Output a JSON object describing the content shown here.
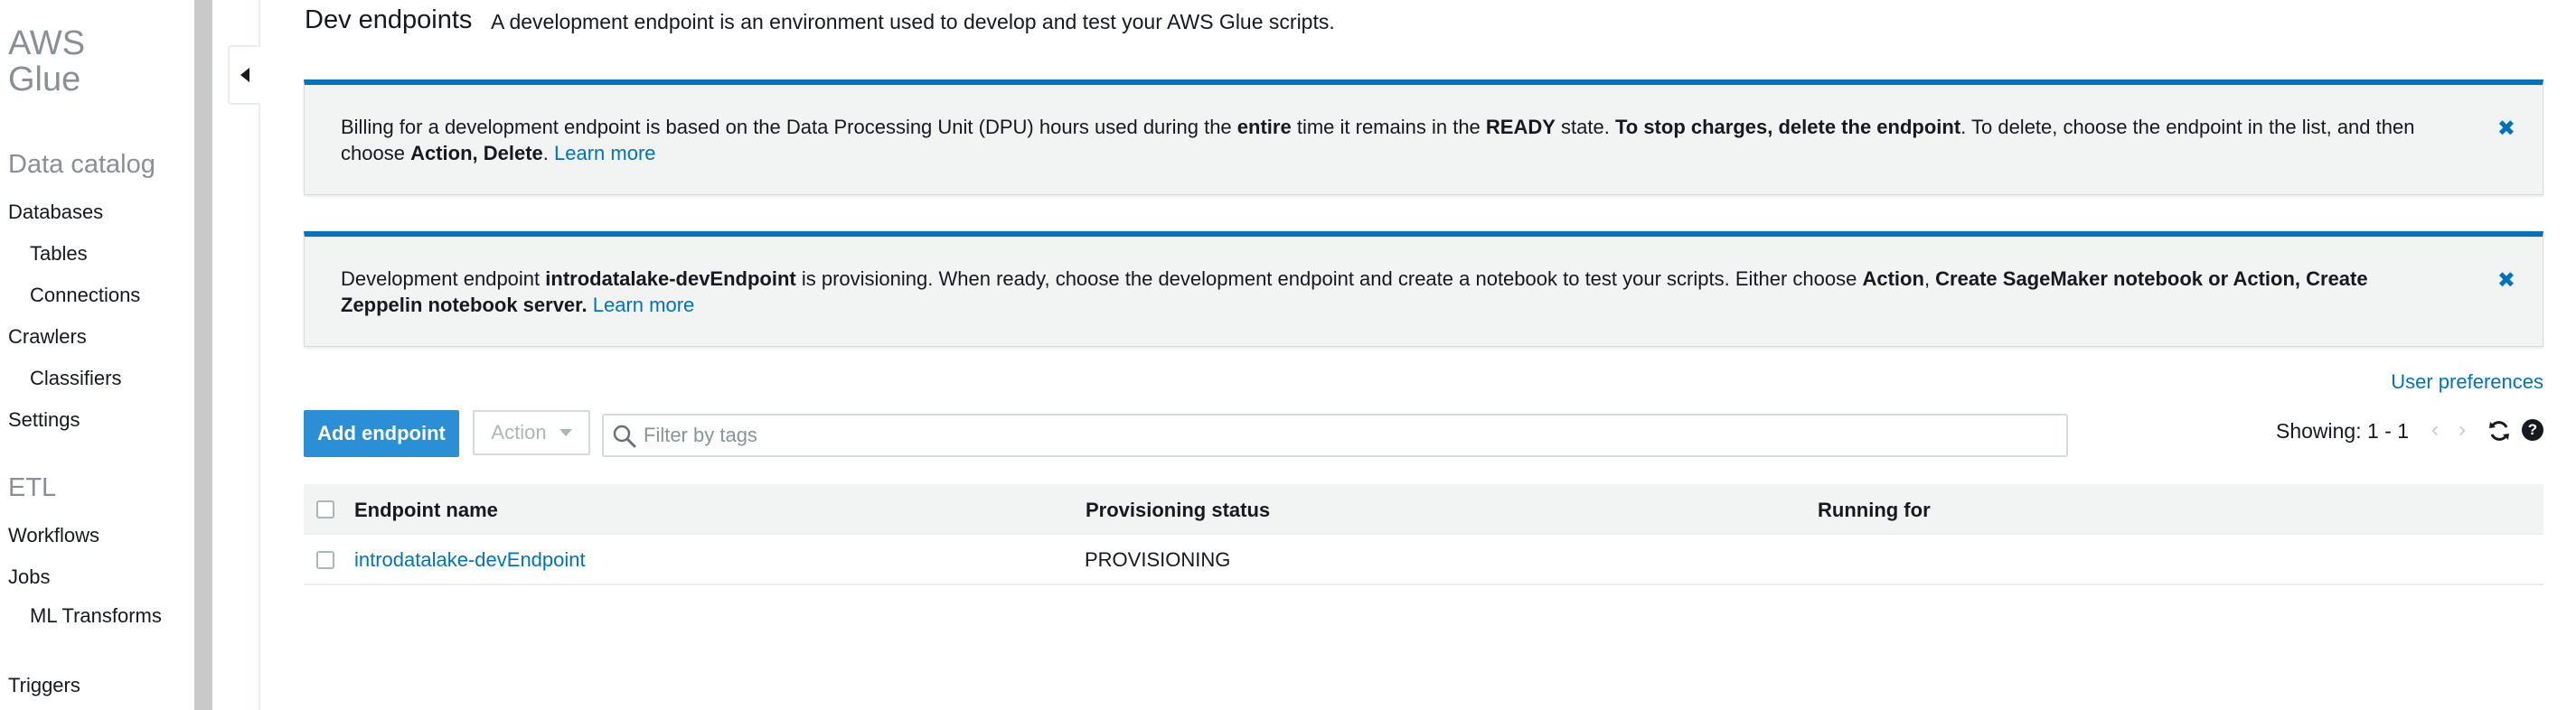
{
  "sidebar": {
    "brand_line1": "AWS",
    "brand_line2": "Glue",
    "data_catalog": {
      "title": "Data catalog",
      "items": [
        "Databases",
        "Tables",
        "Connections",
        "Crawlers",
        "Classifiers",
        "Settings"
      ]
    },
    "etl": {
      "title": "ETL",
      "items": [
        "Workflows",
        "Jobs",
        "ML Transforms",
        "Triggers"
      ]
    }
  },
  "header": {
    "title": "Dev endpoints",
    "description": "A development endpoint is an environment used to develop and test your AWS Glue scripts."
  },
  "alerts": {
    "billing": {
      "t1": "Billing for a development endpoint is based on the Data Processing Unit (DPU) hours used during the ",
      "b1": "entire",
      "t2": " time it remains in the ",
      "b2": "READY",
      "t3": " state. ",
      "b3": "To stop charges, delete the endpoint",
      "t4": ". To delete, choose the endpoint in the list, and then choose ",
      "b4": "Action, Delete",
      "t5": ". ",
      "link": "Learn more"
    },
    "provisioning": {
      "t1": "Development endpoint ",
      "b1": "introdatalake-devEndpoint",
      "t2": " is provisioning. When ready, choose the development endpoint and create a notebook to test your scripts. Either choose ",
      "b2": "Action",
      "t3": ", ",
      "b3": "Create SageMaker notebook or Action, Create Zeppelin notebook server.",
      "t4": " ",
      "link": "Learn more"
    },
    "close_glyph": "✖"
  },
  "toolbar": {
    "user_preferences": "User preferences",
    "add_endpoint": "Add endpoint",
    "action": "Action",
    "filter_placeholder": "Filter by tags",
    "showing": "Showing: 1 - 1",
    "prev": "‹",
    "next": "›",
    "help": "?"
  },
  "table": {
    "columns": [
      "Endpoint name",
      "Provisioning status",
      "Running for"
    ],
    "rows": [
      {
        "name": "introdatalake-devEndpoint",
        "status": "PROVISIONING",
        "running_for": ""
      }
    ]
  },
  "colors": {
    "accent": "#0073bb",
    "primary_button": "#2b8fd6",
    "alert_background": "#f2f3f3"
  }
}
